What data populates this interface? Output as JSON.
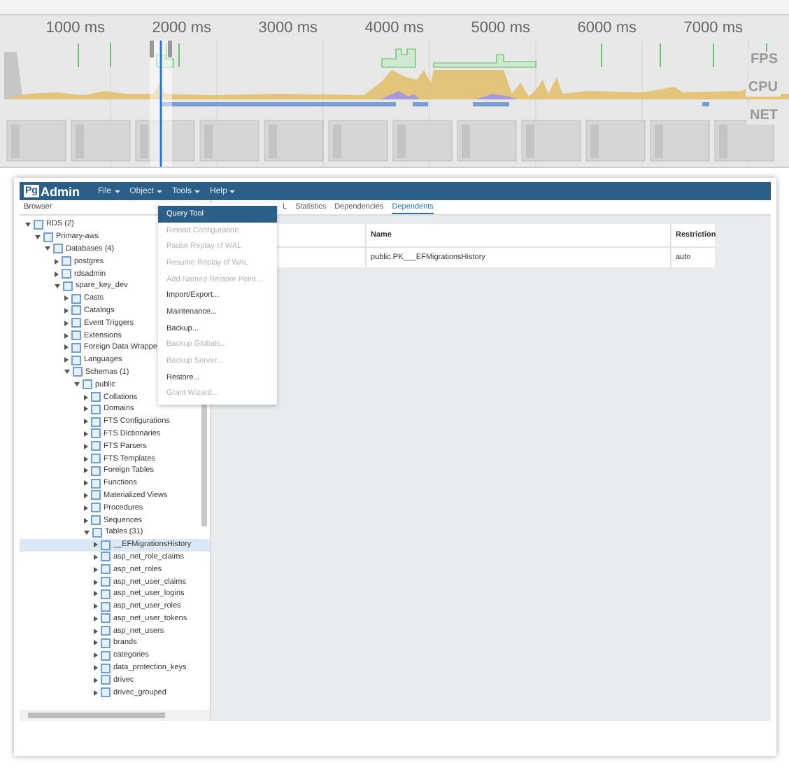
{
  "overview": {
    "ticks": [
      "1000 ms",
      "2000 ms",
      "3000 ms",
      "4000 ms",
      "5000 ms",
      "6000 ms",
      "7000 ms"
    ],
    "lanes": [
      "FPS",
      "CPU",
      "NET"
    ]
  },
  "pgadmin": {
    "logo_badge": "Pg",
    "logo_text": "Admin",
    "menus": [
      "File",
      "Object",
      "Tools",
      "Help"
    ],
    "browser_title": "Browser",
    "tree": [
      {
        "label": "RDS (2)",
        "expanded": true,
        "selected": false,
        "children": [
          {
            "label": "Primary-aws",
            "expanded": true,
            "selected": false,
            "children": [
              {
                "label": "Databases (4)",
                "expanded": true,
                "selected": false,
                "children": [
                  {
                    "label": "postgres",
                    "expanded": false,
                    "selected": false
                  },
                  {
                    "label": "rdsadmin",
                    "expanded": false,
                    "selected": false
                  },
                  {
                    "label": "spare_key_dev",
                    "expanded": true,
                    "selected": false,
                    "children": [
                      {
                        "label": "Casts",
                        "expanded": false,
                        "selected": false
                      },
                      {
                        "label": "Catalogs",
                        "expanded": false,
                        "selected": false
                      },
                      {
                        "label": "Event Triggers",
                        "expanded": false,
                        "selected": false
                      },
                      {
                        "label": "Extensions",
                        "expanded": false,
                        "selected": false
                      },
                      {
                        "label": "Foreign Data Wrappe",
                        "expanded": false,
                        "selected": false
                      },
                      {
                        "label": "Languages",
                        "expanded": false,
                        "selected": false
                      },
                      {
                        "label": "Schemas (1)",
                        "expanded": true,
                        "selected": false,
                        "children": [
                          {
                            "label": "public",
                            "expanded": true,
                            "selected": false,
                            "children": [
                              {
                                "label": "Collations",
                                "expanded": false,
                                "selected": false
                              },
                              {
                                "label": "Domains",
                                "expanded": false,
                                "selected": false
                              },
                              {
                                "label": "FTS Configurations",
                                "expanded": false,
                                "selected": false
                              },
                              {
                                "label": "FTS Dictionaries",
                                "expanded": false,
                                "selected": false
                              },
                              {
                                "label": "FTS Parsers",
                                "expanded": false,
                                "selected": false
                              },
                              {
                                "label": "FTS Templates",
                                "expanded": false,
                                "selected": false
                              },
                              {
                                "label": "Foreign Tables",
                                "expanded": false,
                                "selected": false
                              },
                              {
                                "label": "Functions",
                                "expanded": false,
                                "selected": false
                              },
                              {
                                "label": "Materialized Views",
                                "expanded": false,
                                "selected": false
                              },
                              {
                                "label": "Procedures",
                                "expanded": false,
                                "selected": false
                              },
                              {
                                "label": "Sequences",
                                "expanded": false,
                                "selected": false
                              },
                              {
                                "label": "Tables (31)",
                                "expanded": true,
                                "selected": false,
                                "children": [
                                  {
                                    "label": "__EFMigrationsHistory",
                                    "expanded": false,
                                    "selected": true
                                  },
                                  {
                                    "label": "asp_net_role_claims",
                                    "expanded": false,
                                    "selected": false
                                  },
                                  {
                                    "label": "asp_net_roles",
                                    "expanded": false,
                                    "selected": false
                                  },
                                  {
                                    "label": "asp_net_user_claims",
                                    "expanded": false,
                                    "selected": false
                                  },
                                  {
                                    "label": "asp_net_user_logins",
                                    "expanded": false,
                                    "selected": false
                                  },
                                  {
                                    "label": "asp_net_user_roles",
                                    "expanded": false,
                                    "selected": false
                                  },
                                  {
                                    "label": "asp_net_user_tokens",
                                    "expanded": false,
                                    "selected": false
                                  },
                                  {
                                    "label": "asp_net_users",
                                    "expanded": false,
                                    "selected": false
                                  },
                                  {
                                    "label": "brands",
                                    "expanded": false,
                                    "selected": false
                                  },
                                  {
                                    "label": "categories",
                                    "expanded": false,
                                    "selected": false
                                  },
                                  {
                                    "label": "data_protection_keys",
                                    "expanded": false,
                                    "selected": false
                                  },
                                  {
                                    "label": "drivec",
                                    "expanded": false,
                                    "selected": false
                                  },
                                  {
                                    "label": "drivec_grouped",
                                    "expanded": false,
                                    "selected": false
                                  }
                                ]
                              }
                            ]
                          }
                        ]
                      }
                    ]
                  }
                ]
              }
            ]
          }
        ]
      }
    ],
    "tools_menu": [
      {
        "label": "Query Tool",
        "selected": true,
        "disabled": false
      },
      {
        "label": "Reload Configuration",
        "selected": false,
        "disabled": true
      },
      {
        "label": "Pause Replay of WAL",
        "selected": false,
        "disabled": true
      },
      {
        "label": "Resume Replay of WAL",
        "selected": false,
        "disabled": true
      },
      {
        "label": "Add Named Restore Point...",
        "selected": false,
        "disabled": true
      },
      {
        "label": "Import/Export...",
        "selected": false,
        "disabled": false
      },
      {
        "label": "Maintenance...",
        "selected": false,
        "disabled": false
      },
      {
        "label": "Backup...",
        "selected": false,
        "disabled": false
      },
      {
        "label": "Backup Globals...",
        "selected": false,
        "disabled": true
      },
      {
        "label": "Backup Server...",
        "selected": false,
        "disabled": true
      },
      {
        "label": "Restore...",
        "selected": false,
        "disabled": false
      },
      {
        "label": "Grant Wizard...",
        "selected": false,
        "disabled": true
      }
    ],
    "tabs": [
      {
        "label": "L",
        "selected": false
      },
      {
        "label": "Statistics",
        "selected": false
      },
      {
        "label": "Dependencies",
        "selected": false
      },
      {
        "label": "Dependents",
        "selected": true
      }
    ],
    "table": {
      "columns": [
        "Name",
        "Restriction"
      ],
      "rows": [
        [
          "public.PK___EFMigrationsHistory",
          "auto"
        ]
      ]
    }
  }
}
